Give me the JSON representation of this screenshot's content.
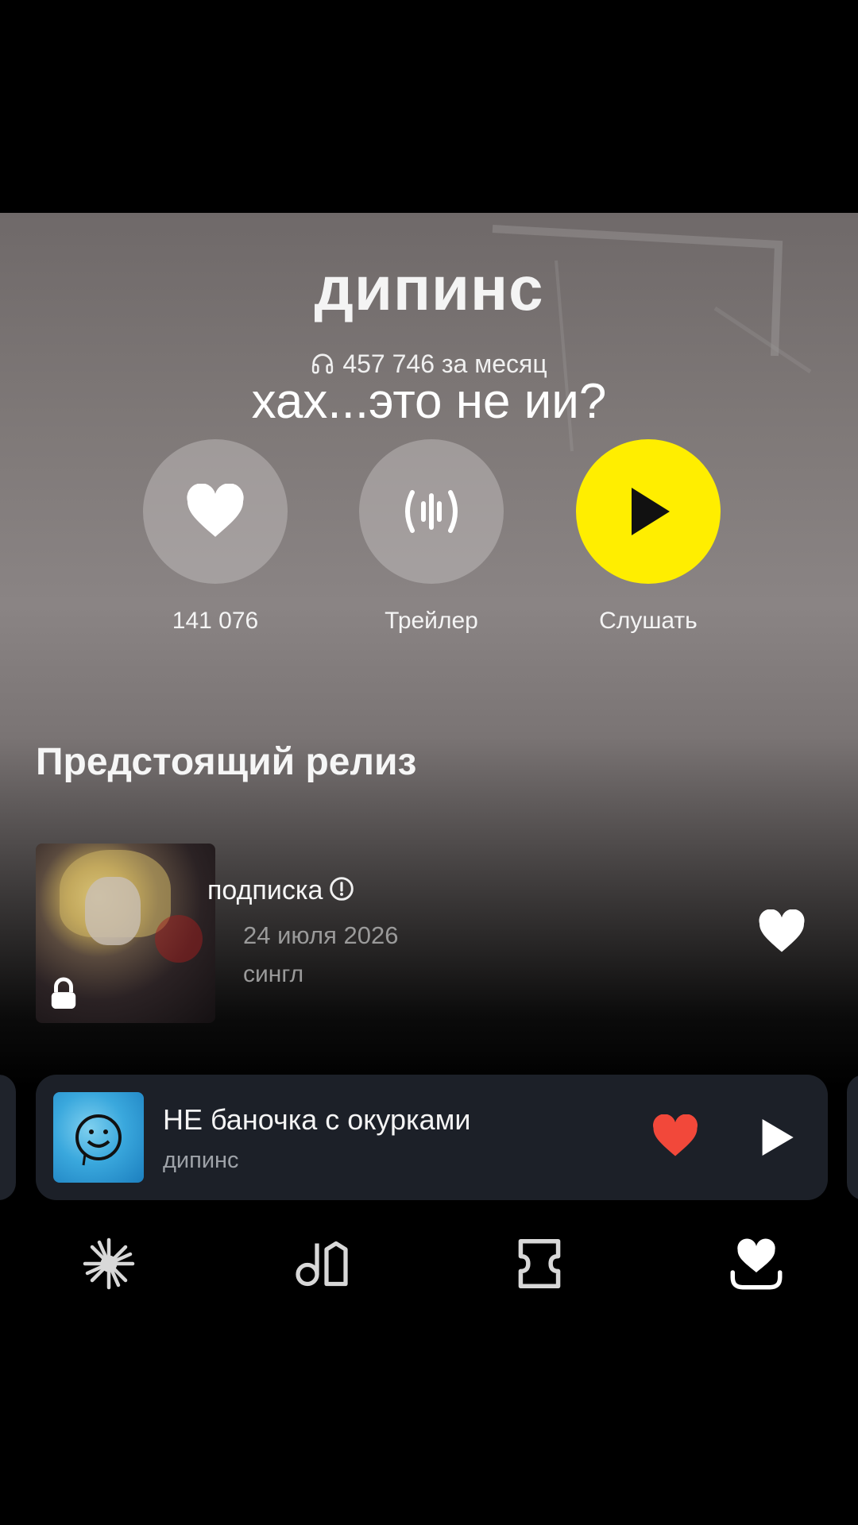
{
  "artist": {
    "name": "дипинс",
    "listeners": "457 746 за месяц",
    "overlay_caption": "хах...это не ии?"
  },
  "actions": {
    "like_count": "141 076",
    "trailer_label": "Трейлер",
    "listen_label": "Слушать"
  },
  "upcoming": {
    "section_title": "Предстоящий релиз",
    "title": "подписка",
    "date": "24 июля 2026",
    "type": "сингл"
  },
  "now_playing": {
    "title": "НЕ баночка с окурками",
    "artist": "дипинс"
  },
  "nav": {
    "items": [
      "wave-icon",
      "music-library-icon",
      "ticket-icon",
      "collection-heart-icon"
    ]
  },
  "colors": {
    "accent_yellow": "#ffee00",
    "liked_red": "#f2483a",
    "player_bg": "#1c2028"
  }
}
